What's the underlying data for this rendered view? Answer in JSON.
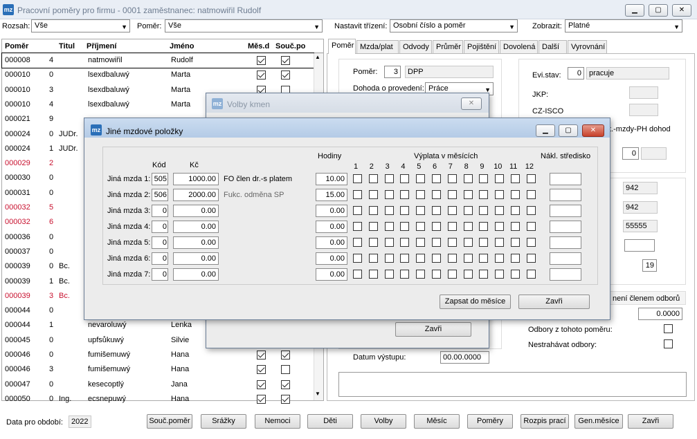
{
  "window": {
    "title": "Pracovní poměry pro firmu - 0001 zaměstnanec: natmowiřil Rudolf",
    "logo": "mz"
  },
  "filters": {
    "rozsah_label": "Rozsah:",
    "rozsah_value": "Vše",
    "pomer_label": "Poměr:",
    "pomer_value": "Vše",
    "trideni_label": "Nastavit třízení:",
    "trideni_value": "Osobní číslo a poměr",
    "zobrazit_label": "Zobrazit:",
    "zobrazit_value": "Platné"
  },
  "list": {
    "headers": [
      "Poměr",
      "Titul",
      "Příjmení",
      "Jméno",
      "Měs.d",
      "Souč.po"
    ],
    "rows": [
      {
        "id": "000008",
        "n": "4",
        "titul": "",
        "prijmeni": "natmowiřil",
        "jmeno": "Rudolf",
        "red": false,
        "mes": true,
        "souc": true
      },
      {
        "id": "000010",
        "n": "0",
        "titul": "",
        "prijmeni": "lsexdbaluwý",
        "jmeno": "Marta",
        "red": false,
        "mes": true,
        "souc": true
      },
      {
        "id": "000010",
        "n": "3",
        "titul": "",
        "prijmeni": "lsexdbaluwý",
        "jmeno": "Marta",
        "red": false,
        "mes": true,
        "souc": false
      },
      {
        "id": "000010",
        "n": "4",
        "titul": "",
        "prijmeni": "lsexdbaluwý",
        "jmeno": "Marta",
        "red": false,
        "mes": true,
        "souc": false
      },
      {
        "id": "000021",
        "n": "9",
        "titul": "",
        "prijmeni": "",
        "jmeno": "",
        "red": false,
        "mes": false,
        "souc": false
      },
      {
        "id": "000024",
        "n": "0",
        "titul": "JUDr.",
        "prijmeni": "",
        "jmeno": "",
        "red": false,
        "mes": false,
        "souc": false
      },
      {
        "id": "000024",
        "n": "1",
        "titul": "JUDr.",
        "prijmeni": "",
        "jmeno": "",
        "red": false,
        "mes": false,
        "souc": false
      },
      {
        "id": "000029",
        "n": "2",
        "titul": "",
        "prijmeni": "",
        "jmeno": "",
        "red": true,
        "mes": false,
        "souc": false
      },
      {
        "id": "000030",
        "n": "0",
        "titul": "",
        "prijmeni": "",
        "jmeno": "",
        "red": false,
        "mes": false,
        "souc": false
      },
      {
        "id": "000031",
        "n": "0",
        "titul": "",
        "prijmeni": "",
        "jmeno": "",
        "red": false,
        "mes": false,
        "souc": false
      },
      {
        "id": "000032",
        "n": "5",
        "titul": "",
        "prijmeni": "",
        "jmeno": "",
        "red": true,
        "mes": false,
        "souc": false
      },
      {
        "id": "000032",
        "n": "6",
        "titul": "",
        "prijmeni": "",
        "jmeno": "",
        "red": true,
        "mes": false,
        "souc": false
      },
      {
        "id": "000036",
        "n": "0",
        "titul": "",
        "prijmeni": "",
        "jmeno": "",
        "red": false,
        "mes": false,
        "souc": false
      },
      {
        "id": "000037",
        "n": "0",
        "titul": "",
        "prijmeni": "",
        "jmeno": "",
        "red": false,
        "mes": false,
        "souc": false
      },
      {
        "id": "000039",
        "n": "0",
        "titul": "Bc.",
        "prijmeni": "",
        "jmeno": "",
        "red": false,
        "mes": false,
        "souc": false
      },
      {
        "id": "000039",
        "n": "1",
        "titul": "Bc.",
        "prijmeni": "",
        "jmeno": "",
        "red": false,
        "mes": false,
        "souc": false
      },
      {
        "id": "000039",
        "n": "3",
        "titul": "Bc.",
        "prijmeni": "",
        "jmeno": "",
        "red": true,
        "mes": false,
        "souc": false
      },
      {
        "id": "000044",
        "n": "0",
        "titul": "",
        "prijmeni": "",
        "jmeno": "",
        "red": false,
        "mes": false,
        "souc": false
      },
      {
        "id": "000044",
        "n": "1",
        "titul": "",
        "prijmeni": "nevaroluwý",
        "jmeno": "Lenka",
        "red": false,
        "mes": false,
        "souc": false
      },
      {
        "id": "000045",
        "n": "0",
        "titul": "",
        "prijmeni": "upfsůkuwý",
        "jmeno": "Silvie",
        "red": false,
        "mes": false,
        "souc": false
      },
      {
        "id": "000046",
        "n": "0",
        "titul": "",
        "prijmeni": "fumišemuwý",
        "jmeno": "Hana",
        "red": false,
        "mes": true,
        "souc": true
      },
      {
        "id": "000046",
        "n": "3",
        "titul": "",
        "prijmeni": "fumišemuwý",
        "jmeno": "Hana",
        "red": false,
        "mes": true,
        "souc": false
      },
      {
        "id": "000047",
        "n": "0",
        "titul": "",
        "prijmeni": "kesecoptlý",
        "jmeno": "Jana",
        "red": false,
        "mes": true,
        "souc": true
      },
      {
        "id": "000050",
        "n": "0",
        "titul": "Ing.",
        "prijmeni": "ecsnepuwý",
        "jmeno": "Hana",
        "red": false,
        "mes": true,
        "souc": true
      }
    ]
  },
  "tabs": [
    "Poměr",
    "Mzda/plat",
    "Odvody",
    "Průměr",
    "Pojištění",
    "Dovolená",
    "Další",
    "Vyrovnání"
  ],
  "pomer_panel": {
    "pomer_label": "Poměr:",
    "pomer_num": "3",
    "pomer_text": "DPP",
    "dohoda_label": "Dohoda o provedení:",
    "dohoda_value": "Práce",
    "datum_vystupu_label": "Datum výstupu:",
    "datum_vystupu_value": "00.00.0000",
    "evi_label": "Evi.stav:",
    "evi_num": "0",
    "evi_text": "pracuje",
    "jkp_label": "JKP:",
    "czisco_label": "CZ-ISCO",
    "mzdy_text": "t.-mzdy-PH dohod",
    "small_num": "0",
    "v942a": "942",
    "v942b": "942",
    "v55555": "55555",
    "v19": "19",
    "odbory_label": "není členem odborů",
    "odbory_value": "0.0000",
    "odbory_pomer_label": "Odbory z tohoto poměru:",
    "nestrahavat_label": "Nestrahávat odbory:"
  },
  "bottom": {
    "data_label": "Data pro období:",
    "year": "2022",
    "buttons": [
      "Souč.poměr",
      "Srážky",
      "Nemoci",
      "Děti",
      "Volby",
      "Měsíc",
      "Poměry",
      "Rozpis prací",
      "Gen.měsíce",
      "Zavři"
    ]
  },
  "volby_dialog": {
    "title": "Volby kmen",
    "close_label": "Zavři"
  },
  "jine_dialog": {
    "title": "Jiné mzdové položky",
    "col_kod": "Kód",
    "col_kc": "Kč",
    "col_hodiny": "Hodiny",
    "col_vyplata": "Výplata v měsících",
    "col_naklad": "Nákl. středisko",
    "months": [
      "1",
      "2",
      "3",
      "4",
      "5",
      "6",
      "7",
      "8",
      "9",
      "10",
      "11",
      "12"
    ],
    "rows": [
      {
        "label": "Jiná mzda 1:",
        "kod": "505",
        "kc": "1000.00",
        "popis": "FO člen dr.-s platem",
        "popis_grey": false,
        "hodiny": "10.00"
      },
      {
        "label": "Jiná mzda 2:",
        "kod": "506",
        "kc": "2000.00",
        "popis": "Fukc. odměna SP",
        "popis_grey": true,
        "hodiny": "15.00"
      },
      {
        "label": "Jiná mzda 3:",
        "kod": "0",
        "kc": "0.00",
        "popis": "",
        "popis_grey": false,
        "hodiny": "0.00"
      },
      {
        "label": "Jiná mzda 4:",
        "kod": "0",
        "kc": "0.00",
        "popis": "",
        "popis_grey": false,
        "hodiny": "0.00"
      },
      {
        "label": "Jiná mzda 5:",
        "kod": "0",
        "kc": "0.00",
        "popis": "",
        "popis_grey": false,
        "hodiny": "0.00"
      },
      {
        "label": "Jiná mzda 6:",
        "kod": "0",
        "kc": "0.00",
        "popis": "",
        "popis_grey": false,
        "hodiny": "0.00"
      },
      {
        "label": "Jiná mzda 7:",
        "kod": "0",
        "kc": "0.00",
        "popis": "",
        "popis_grey": false,
        "hodiny": "0.00"
      }
    ],
    "zapsat_label": "Zapsat do měsíce",
    "zavri_label": "Zavři"
  }
}
